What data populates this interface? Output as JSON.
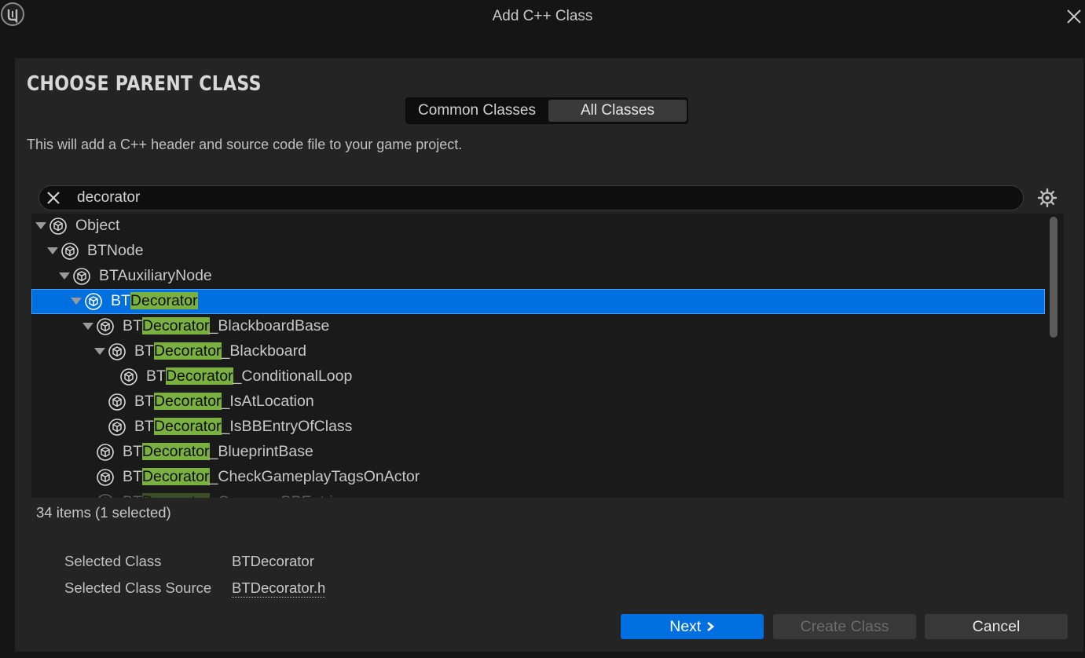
{
  "window": {
    "title": "Add C++ Class"
  },
  "page": {
    "heading": "CHOOSE PARENT CLASS",
    "description": "This will add a C++ header and source code file to your game project."
  },
  "tabs": [
    {
      "label": "Common Classes",
      "active": false
    },
    {
      "label": "All Classes",
      "active": true
    }
  ],
  "search": {
    "value": "decorator",
    "placeholder": ""
  },
  "tree": {
    "highlight_color": "#79b040",
    "selection_color": "#0070e0",
    "rows": [
      {
        "prefix": "Object",
        "match": "",
        "suffix": "",
        "depth": 0,
        "expanded": true,
        "selected": false
      },
      {
        "prefix": "BTNode",
        "match": "",
        "suffix": "",
        "depth": 1,
        "expanded": true,
        "selected": false
      },
      {
        "prefix": "BTAuxiliaryNode",
        "match": "",
        "suffix": "",
        "depth": 2,
        "expanded": true,
        "selected": false
      },
      {
        "prefix": "BT",
        "match": "Decorator",
        "suffix": "",
        "depth": 3,
        "expanded": true,
        "selected": true
      },
      {
        "prefix": "BT",
        "match": "Decorator",
        "suffix": "_BlackboardBase",
        "depth": 4,
        "expanded": true,
        "selected": false
      },
      {
        "prefix": "BT",
        "match": "Decorator",
        "suffix": "_Blackboard",
        "depth": 5,
        "expanded": true,
        "selected": false
      },
      {
        "prefix": "BT",
        "match": "Decorator",
        "suffix": "_ConditionalLoop",
        "depth": 6,
        "expanded": false,
        "selected": false
      },
      {
        "prefix": "BT",
        "match": "Decorator",
        "suffix": "_IsAtLocation",
        "depth": 5,
        "expanded": false,
        "selected": false
      },
      {
        "prefix": "BT",
        "match": "Decorator",
        "suffix": "_IsBBEntryOfClass",
        "depth": 5,
        "expanded": false,
        "selected": false
      },
      {
        "prefix": "BT",
        "match": "Decorator",
        "suffix": "_BlueprintBase",
        "depth": 4,
        "expanded": false,
        "selected": false
      },
      {
        "prefix": "BT",
        "match": "Decorator",
        "suffix": "_CheckGameplayTagsOnActor",
        "depth": 4,
        "expanded": false,
        "selected": false
      },
      {
        "prefix": "BT",
        "match": "Decorator",
        "suffix": "_CompareBBEntries",
        "depth": 4,
        "expanded": false,
        "selected": false
      }
    ]
  },
  "status": {
    "count_text": "34 items (1 selected)"
  },
  "info": {
    "selected_class_label": "Selected Class",
    "selected_class_value": "BTDecorator",
    "selected_source_label": "Selected Class Source",
    "selected_source_value": "BTDecorator.h"
  },
  "buttons": {
    "next": "Next",
    "create": "Create Class",
    "cancel": "Cancel"
  }
}
